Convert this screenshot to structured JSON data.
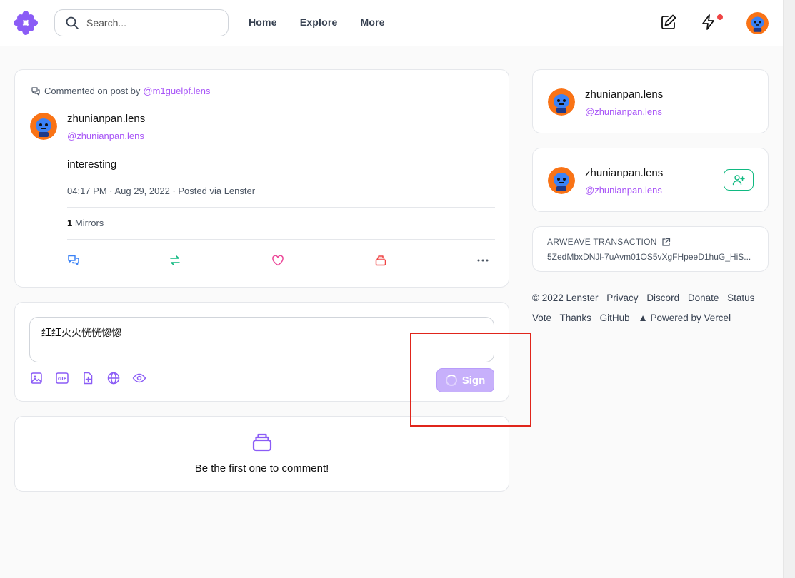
{
  "header": {
    "search_placeholder": "Search...",
    "nav": [
      "Home",
      "Explore",
      "More"
    ]
  },
  "post": {
    "comment_prefix": "Commented on post by",
    "comment_target": "@m1guelpf.lens",
    "author_name": "zhunianpan.lens",
    "author_handle": "@zhunianpan.lens",
    "text": "interesting",
    "timestamp": "04:17 PM · Aug 29, 2022 · Posted via Lenster",
    "mirrors_count": "1",
    "mirrors_label": "Mirrors"
  },
  "composer": {
    "text": "红红火火恍恍惚惚",
    "sign_label": "Sign"
  },
  "empty": {
    "text": "Be the first one to comment!"
  },
  "sidebar": {
    "profile_card": {
      "name": "zhunianpan.lens",
      "handle": "@zhunianpan.lens"
    },
    "follow_card": {
      "name": "zhunianpan.lens",
      "handle": "@zhunianpan.lens"
    },
    "arweave": {
      "title": "ARWEAVE TRANSACTION",
      "hash": "5ZedMbxDNJl-7uAvm01OS5vXgFHpeeD1huG_HiS..."
    }
  },
  "footer": {
    "copyright": "© 2022 Lenster",
    "links": [
      "Privacy",
      "Discord",
      "Donate",
      "Status",
      "Vote",
      "Thanks",
      "GitHub",
      "▲ Powered by Vercel"
    ]
  },
  "colors": {
    "brand": "#a855f7",
    "sign_button": "#c7b0fb",
    "follow": "#10b981",
    "annotation_box": "#e0251b"
  }
}
